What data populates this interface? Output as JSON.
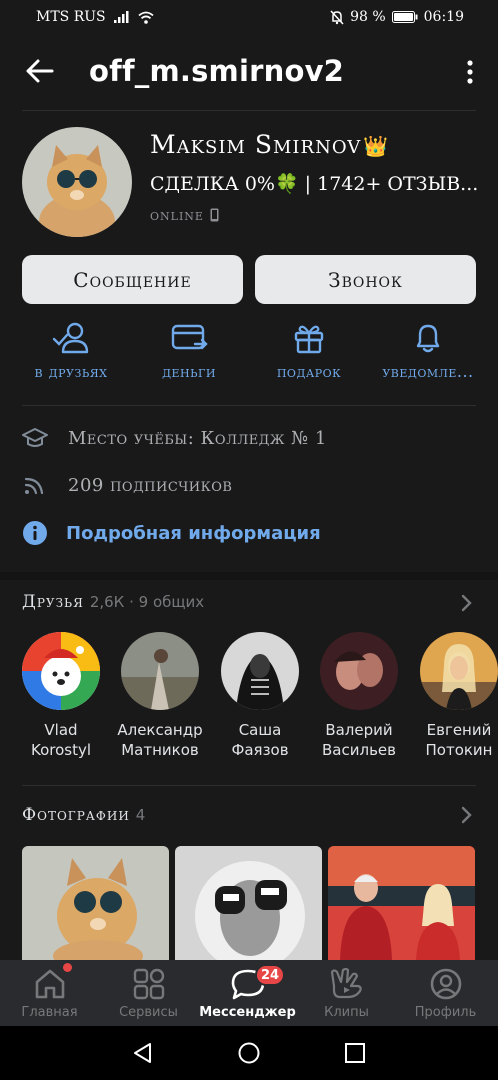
{
  "status_bar": {
    "carrier": "MTS RUS",
    "battery": "98 %",
    "time": "06:19"
  },
  "header": {
    "username": "off_m.smirnov2"
  },
  "profile": {
    "name": "Maksim Smirnov",
    "name_emoji": "👑",
    "status": "СДЕЛКА 0%🍀 | 1742+ ОТЗЫВ...",
    "online": "online"
  },
  "buttons": {
    "message": "Сообщение",
    "call": "Звонок"
  },
  "actions": [
    {
      "label": "в друзьях",
      "icon": "friends-check-icon"
    },
    {
      "label": "деньги",
      "icon": "money-transfer-icon"
    },
    {
      "label": "подарок",
      "icon": "gift-icon"
    },
    {
      "label": "уведомле...",
      "icon": "bell-icon"
    }
  ],
  "info": {
    "education": "Место учёбы: Колледж № 1",
    "followers": "209 подписчиков",
    "details_link": "Подробная информация"
  },
  "friends": {
    "title": "Друзья",
    "subtitle": "2,6К · 9 общих",
    "list": [
      {
        "first": "Vlad",
        "last": "Korostyl"
      },
      {
        "first": "Александр",
        "last": "Матников"
      },
      {
        "first": "Саша",
        "last": "Фаязов"
      },
      {
        "first": "Валерий",
        "last": "Васильев"
      },
      {
        "first": "Евгений",
        "last": "Потокин"
      }
    ]
  },
  "photos": {
    "title": "Фотографии",
    "count": "4"
  },
  "tabbar": {
    "tabs": [
      {
        "label": "Главная",
        "icon": "home-icon"
      },
      {
        "label": "Сервисы",
        "icon": "services-icon"
      },
      {
        "label": "Мессенджер",
        "icon": "messenger-icon"
      },
      {
        "label": "Клипы",
        "icon": "clips-icon"
      },
      {
        "label": "Профиль",
        "icon": "profile-icon"
      }
    ],
    "messenger_badge": "24"
  },
  "colors": {
    "background": "#19191a",
    "accent": "#71aaeb",
    "badge": "#e64646",
    "button": "#e8e9eb"
  }
}
